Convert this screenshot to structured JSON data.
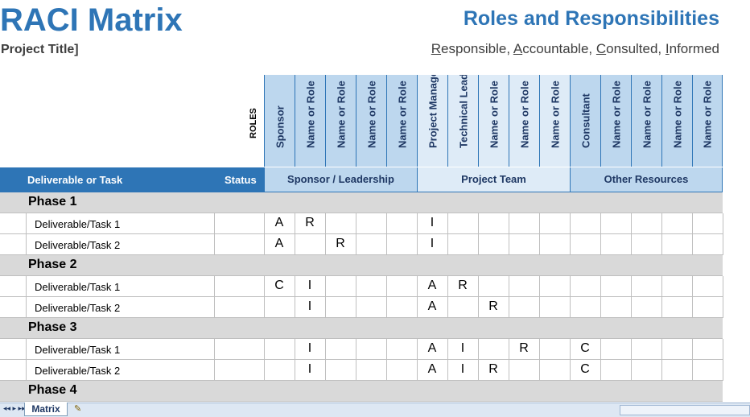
{
  "header": {
    "title": "RACI Matrix",
    "project": "Project Title]",
    "subtitle": "Roles and Responsibilities",
    "legend": [
      "R",
      "esponsible, ",
      "A",
      "ccountable, ",
      "C",
      "onsulted, ",
      "I",
      "nformed"
    ]
  },
  "roles_label": "ROLES",
  "roles": [
    "Sponsor",
    "Name or Role",
    "Name or Role",
    "Name or Role",
    "Name or Role",
    "Project Manager",
    "Technical Lead",
    "Name or Role",
    "Name or Role",
    "Name or Role",
    "Consultant",
    "Name or Role",
    "Name or Role",
    "Name or Role",
    "Name or Role"
  ],
  "columns": {
    "task": "Deliverable or Task",
    "status": "Status"
  },
  "groups": [
    "Sponsor / Leadership",
    "Project Team",
    "Other Resources"
  ],
  "phases": [
    {
      "name": "Phase 1",
      "tasks": [
        {
          "name": "Deliverable/Task 1",
          "values": [
            "A",
            "R",
            "",
            "",
            "",
            "I",
            "",
            "",
            "",
            "",
            "",
            "",
            "",
            "",
            ""
          ]
        },
        {
          "name": "Deliverable/Task 2",
          "values": [
            "A",
            "",
            "R",
            "",
            "",
            "I",
            "",
            "",
            "",
            "",
            "",
            "",
            "",
            "",
            ""
          ]
        }
      ]
    },
    {
      "name": "Phase 2",
      "tasks": [
        {
          "name": "Deliverable/Task 1",
          "values": [
            "C",
            "I",
            "",
            "",
            "",
            "A",
            "R",
            "",
            "",
            "",
            "",
            "",
            "",
            "",
            ""
          ]
        },
        {
          "name": "Deliverable/Task 2",
          "values": [
            "",
            "I",
            "",
            "",
            "",
            "A",
            "",
            "R",
            "",
            "",
            "",
            "",
            "",
            "",
            ""
          ]
        }
      ]
    },
    {
      "name": "Phase 3",
      "tasks": [
        {
          "name": "Deliverable/Task 1",
          "values": [
            "",
            "I",
            "",
            "",
            "",
            "A",
            "I",
            "",
            "R",
            "",
            "C",
            "",
            "",
            "",
            ""
          ]
        },
        {
          "name": "Deliverable/Task 2",
          "values": [
            "",
            "I",
            "",
            "",
            "",
            "A",
            "I",
            "R",
            "",
            "",
            "C",
            "",
            "",
            "",
            ""
          ]
        }
      ]
    },
    {
      "name": "Phase 4",
      "tasks": []
    }
  ],
  "sheet_tab": "Matrix"
}
